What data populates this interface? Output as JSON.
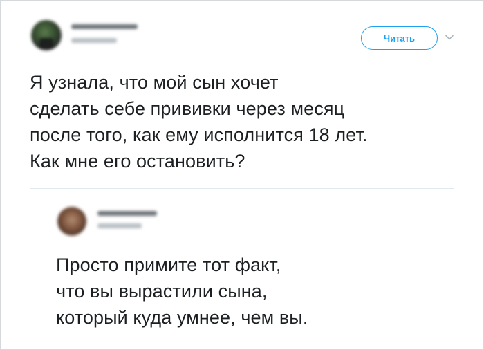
{
  "tweet": {
    "follow_label": "Читать",
    "text": "Я узнала, что мой сын хочет\nсделать себе прививки через месяц\nпосле того, как ему исполнится 18 лет.\nКак мне его остановить?"
  },
  "reply": {
    "text": "Просто примите тот факт,\nчто вы вырастили сына,\nкоторый куда умнее, чем вы."
  },
  "icons": {
    "menu": "chevron-down-icon"
  },
  "colors": {
    "accent": "#1da1f2",
    "text": "#1c2022",
    "divider": "#e1e8ed",
    "border": "#d5d9dc"
  }
}
